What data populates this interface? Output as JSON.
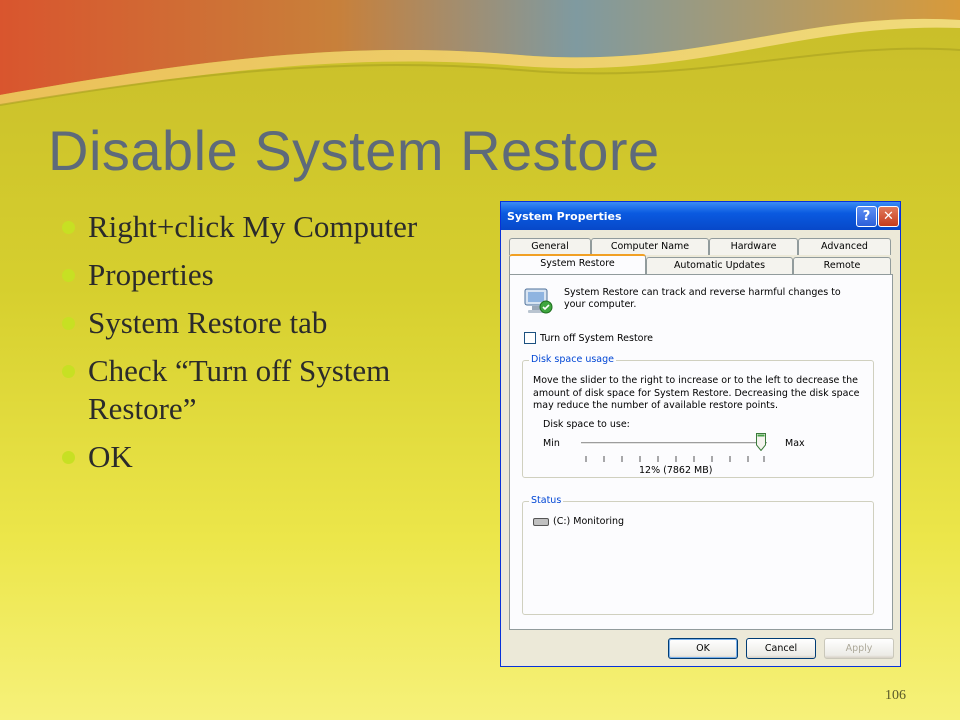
{
  "slide": {
    "title": "Disable System Restore",
    "bullets": [
      "Right+click My Computer",
      "Properties",
      "System Restore tab",
      "Check “Turn off System Restore”",
      "OK"
    ],
    "page_number": "106",
    "colors": {
      "title": "#5e6a7a",
      "bullet_dot": "#c7e023",
      "background": "#d6cf2e"
    }
  },
  "dialog": {
    "title": "System Properties",
    "help_label": "?",
    "close_label": "✕",
    "tabs_row1": [
      "General",
      "Computer Name",
      "Hardware",
      "Advanced"
    ],
    "tabs_row2": [
      "System Restore",
      "Automatic Updates",
      "Remote"
    ],
    "active_tab": "System Restore",
    "intro_text": "System Restore can track and reverse harmful changes to your computer.",
    "turn_off_label": "Turn off System Restore",
    "turn_off_checked": false,
    "disk_group_label": "Disk space usage",
    "disk_description": "Move the slider to the right to increase or to the left to decrease the amount of disk space for System Restore. Decreasing the disk space may reduce the number of available restore points.",
    "disk_space_label": "Disk space to use:",
    "min_label": "Min",
    "max_label": "Max",
    "slider_value_percent": 12,
    "slider_value_label": "12% (7862 MB)",
    "status_group_label": "Status",
    "status_drive": "(C:) Monitoring",
    "buttons": {
      "ok": "OK",
      "cancel": "Cancel",
      "apply": "Apply"
    },
    "icons": [
      "system-restore-icon",
      "help-icon",
      "close-icon",
      "drive-icon"
    ]
  }
}
